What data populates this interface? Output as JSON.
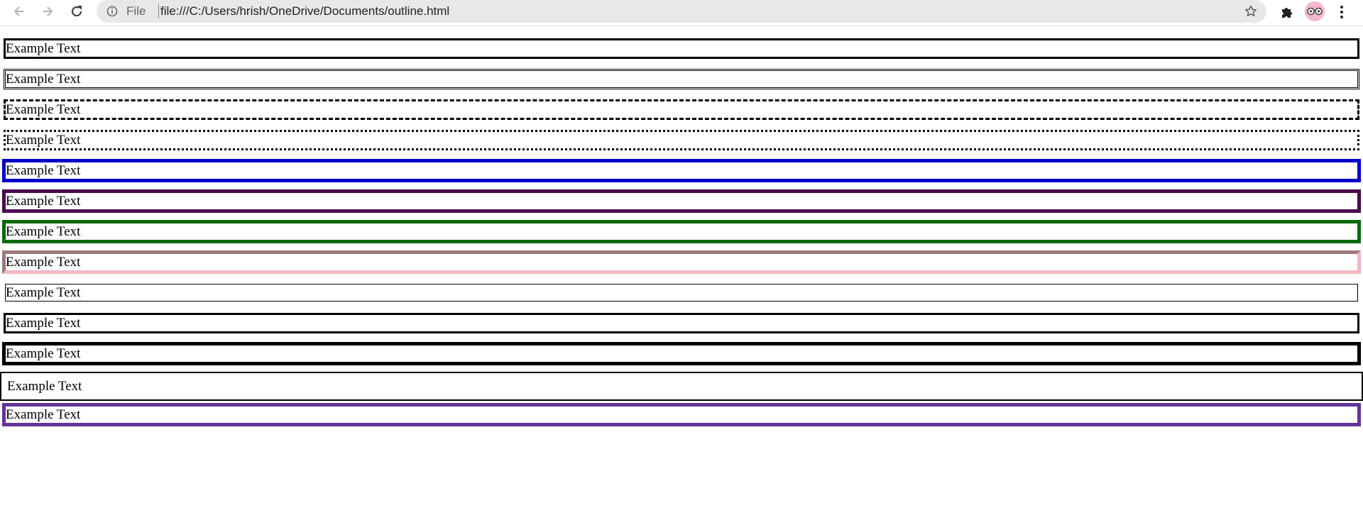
{
  "browser": {
    "scheme_label": "File",
    "url": "file:///C:/Users/hrish/OneDrive/Documents/outline.html",
    "icons": {
      "back": "arrow-left-icon",
      "forward": "arrow-right-icon",
      "reload": "reload-icon",
      "info": "info-icon",
      "bookmark": "star-icon",
      "extensions": "puzzle-icon",
      "avatar": "profile-avatar",
      "menu": "kebab-menu-icon"
    }
  },
  "page": {
    "rows": [
      {
        "text": "Example Text",
        "outline": "3px solid black"
      },
      {
        "text": "Example Text",
        "outline": "3px double black"
      },
      {
        "text": "Example Text",
        "outline": "3px dashed black"
      },
      {
        "text": "Example Text",
        "outline": "3px dotted black"
      },
      {
        "text": "Example Text",
        "outline": "5px solid blue",
        "color": "#0000cd"
      },
      {
        "text": "Example Text",
        "outline": "5px solid purple",
        "color": "#4b0650"
      },
      {
        "text": "Example Text",
        "outline": "5px solid green",
        "color": "#0a6b0a"
      },
      {
        "text": "Example Text",
        "outline": "5px inset pink",
        "color": "#f2b8c0"
      },
      {
        "text": "Example Text",
        "outline": "1px solid black"
      },
      {
        "text": "Example Text",
        "outline": "3px solid black"
      },
      {
        "text": "Example Text",
        "outline": "5px solid black"
      },
      {
        "text": "Example Text",
        "outline": "2px solid black border"
      },
      {
        "text": "Example Text",
        "outline": "5px solid rebeccapurple",
        "color": "#663399"
      }
    ]
  }
}
